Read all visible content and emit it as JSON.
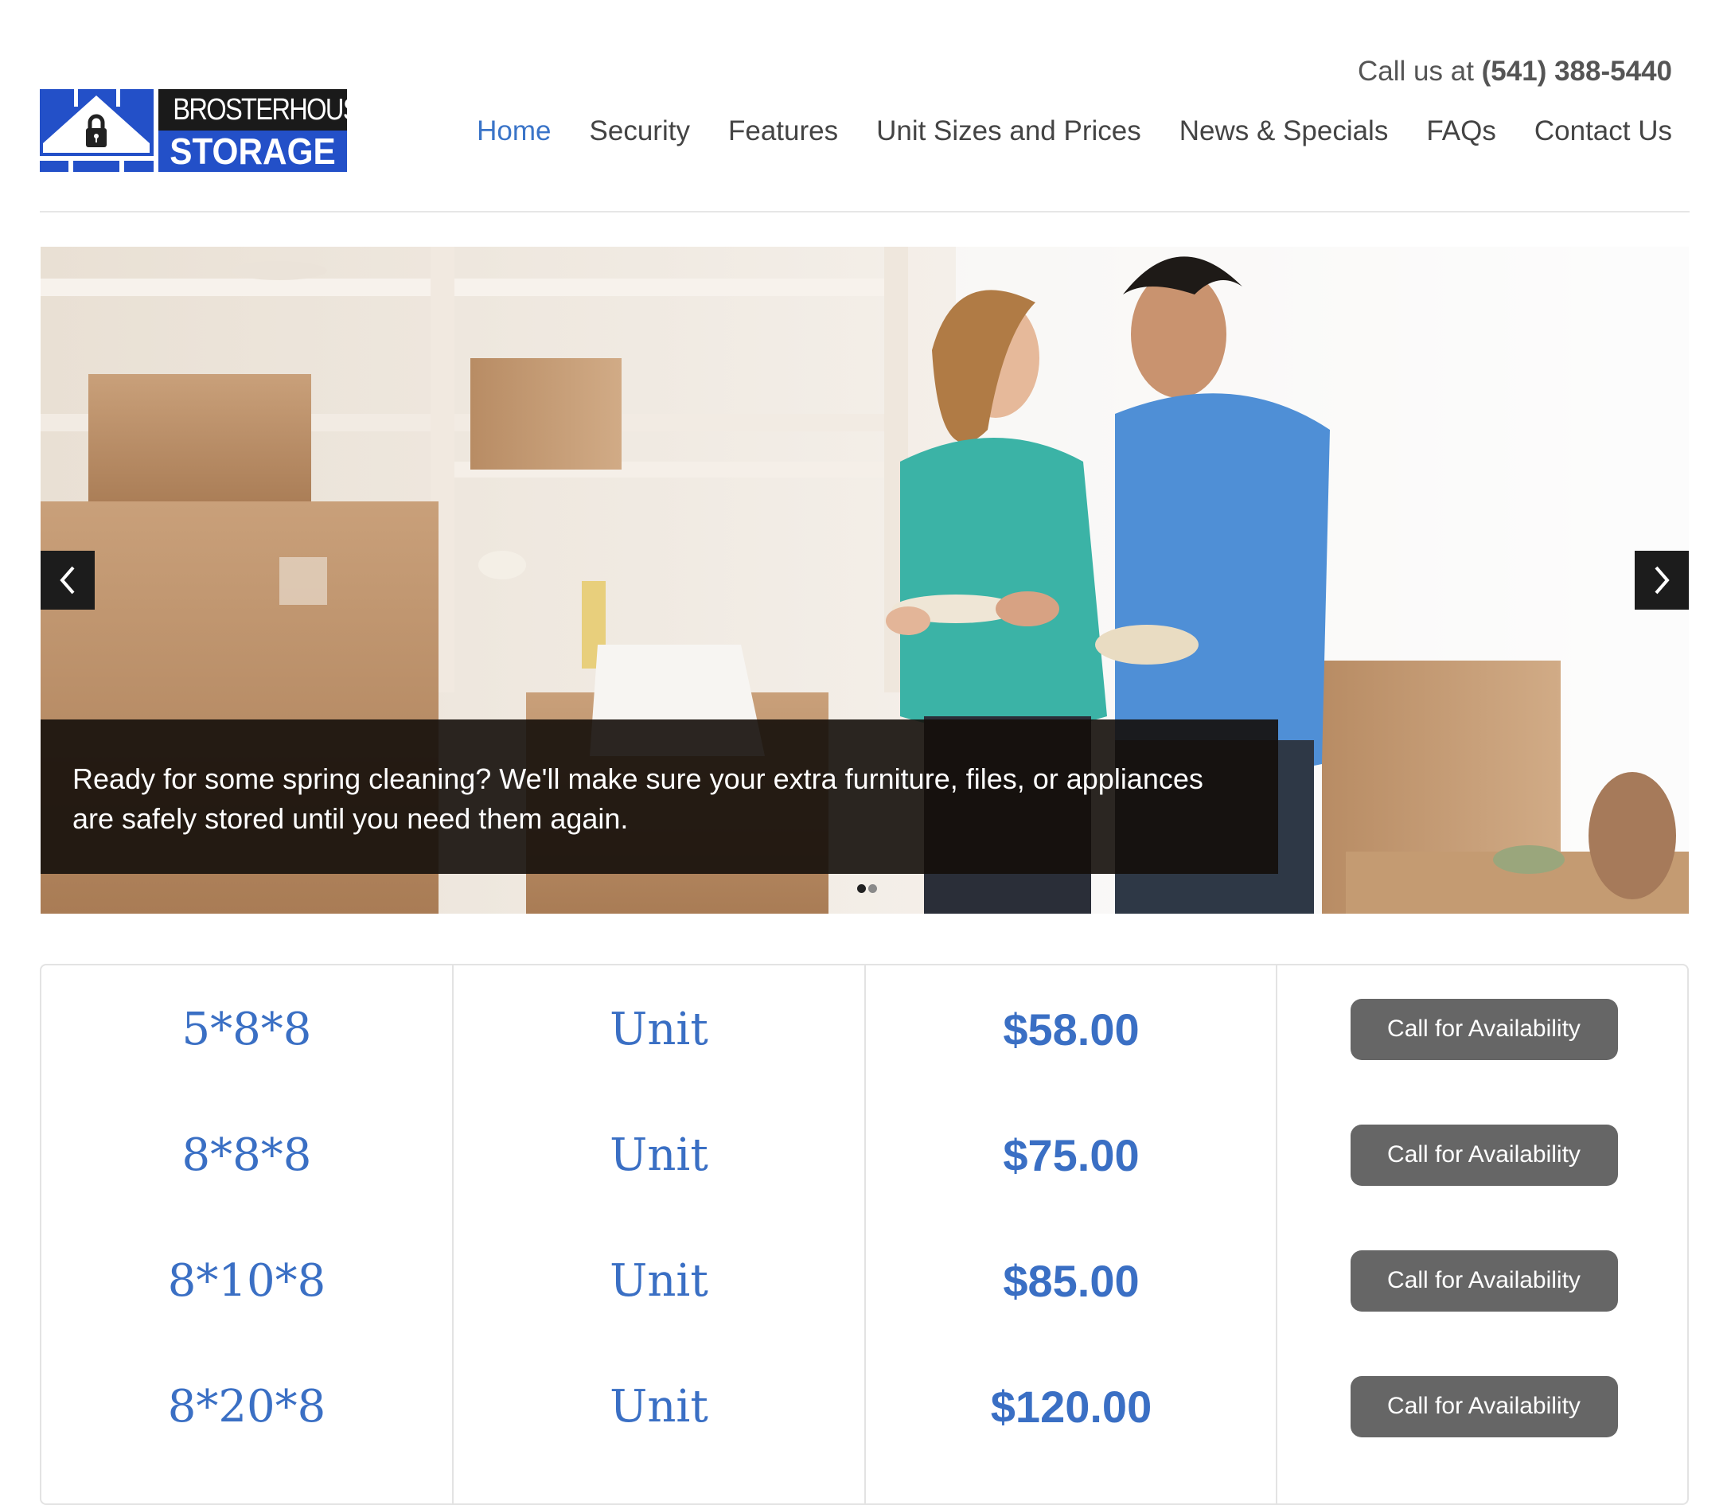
{
  "brand": {
    "logo_line1": "BROSTERHOUS",
    "logo_line2": "STORAGE",
    "brand_blue": "#2350c8"
  },
  "header": {
    "call_prefix": "Call us at",
    "phone": "(541) 388-5440"
  },
  "nav": {
    "items": [
      {
        "label": "Home",
        "active": true
      },
      {
        "label": "Security"
      },
      {
        "label": "Features"
      },
      {
        "label": "Unit Sizes and Prices"
      },
      {
        "label": "News & Specials"
      },
      {
        "label": "FAQs"
      },
      {
        "label": "Contact Us"
      }
    ]
  },
  "hero": {
    "caption": "Ready for some spring cleaning? We'll make sure your extra furniture, files, or appliances are safely stored until you need them again.",
    "slide_count": 2,
    "active_slide": 1,
    "prev_icon": "chevron-left-icon",
    "next_icon": "chevron-right-icon"
  },
  "pricing": {
    "rows": [
      {
        "size": "5*8*8",
        "type": "Unit",
        "price": "$58.00",
        "action": "Call for Availability"
      },
      {
        "size": "8*8*8",
        "type": "Unit",
        "price": "$75.00",
        "action": "Call for Availability"
      },
      {
        "size": "8*10*8",
        "type": "Unit",
        "price": "$85.00",
        "action": "Call for Availability"
      },
      {
        "size": "8*20*8",
        "type": "Unit",
        "price": "$120.00",
        "action": "Call for Availability"
      }
    ],
    "accent": "#3a6fc4"
  }
}
